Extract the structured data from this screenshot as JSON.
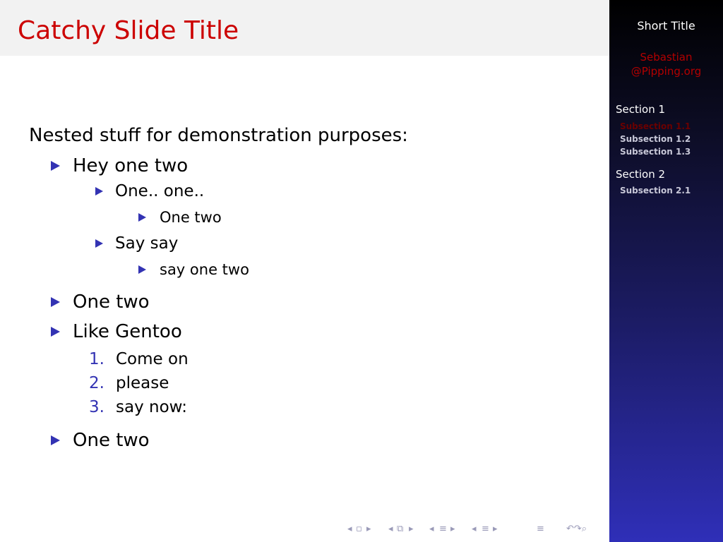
{
  "slide": {
    "title": "Catchy Slide Title",
    "intro": "Nested stuff for demonstration purposes:",
    "items": [
      {
        "text": "Hey one two",
        "children": [
          {
            "text": "One.. one..",
            "children": [
              {
                "text": "One two"
              }
            ]
          },
          {
            "text": "Say say",
            "children": [
              {
                "text": "say one two"
              }
            ]
          }
        ]
      },
      {
        "text": "One two"
      },
      {
        "text": "Like Gentoo",
        "enumerated": [
          {
            "number": "1.",
            "text": "Come on"
          },
          {
            "number": "2.",
            "text": "please"
          },
          {
            "number": "3.",
            "text": "say now:"
          }
        ]
      },
      {
        "text": "One two"
      }
    ]
  },
  "sidebar": {
    "short_title": "Short Title",
    "author_line1": "Sebastian",
    "author_line2": "@Pipping.org",
    "sections": [
      {
        "label": "Section 1",
        "subsections": [
          "Subsection 1.1",
          "Subsection 1.2",
          "Subsection 1.3"
        ]
      },
      {
        "label": "Section 2",
        "subsections": [
          "Subsection 2.1"
        ]
      }
    ]
  },
  "navigation": {
    "icons": [
      "nav-prev-frame-icon",
      "nav-frame-icon",
      "nav-next-frame-icon",
      "nav-prev-subsection-icon",
      "nav-subsection-icon",
      "nav-next-subsection-icon",
      "nav-prev-section-icon",
      "nav-section-icon",
      "nav-next-section-icon",
      "nav-prev-slide-icon",
      "nav-slide-icon",
      "nav-next-slide-icon",
      "nav-toc-icon",
      "nav-search-icon"
    ]
  },
  "colors": {
    "title": "#cc0000",
    "bullet": "#3333b3",
    "sidebar_top": "#000000",
    "sidebar_bottom": "#2f2fb8",
    "author": "#b30000"
  }
}
